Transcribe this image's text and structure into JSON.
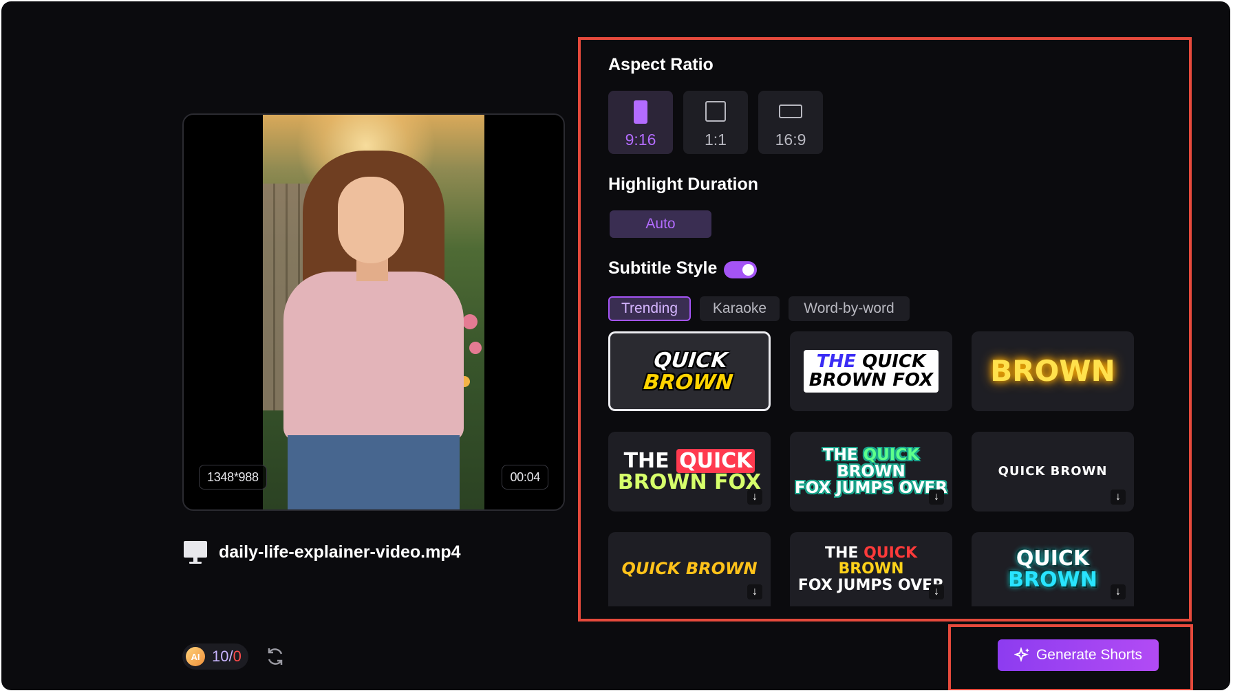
{
  "preview": {
    "resolution": "1348*988",
    "duration": "00:04",
    "file_name": "daily-life-explainer-video.mp4",
    "icon": "monitor-icon"
  },
  "credits": {
    "coin_label": "AI",
    "remaining": "10",
    "separator": "/",
    "used": "0",
    "refresh_icon": "refresh-icon"
  },
  "aspect_ratio": {
    "title": "Aspect Ratio",
    "options": [
      "9:16",
      "1:1",
      "16:9"
    ],
    "selected": "9:16"
  },
  "highlight": {
    "title": "Highlight Duration",
    "value": "Auto"
  },
  "subtitle": {
    "title": "Subtitle Style",
    "enabled": true,
    "tabs": [
      "Trending",
      "Karaoke",
      "Word-by-word"
    ],
    "active_tab": "Trending",
    "styles": [
      {
        "line1_a": "QUICK",
        "line1_b": "BROWN"
      },
      {
        "line1_a": "THE",
        "line1_b": "QUICK",
        "line2": "BROWN FOX"
      },
      {
        "line1_a": "BROWN"
      },
      {
        "line1_a": "THE",
        "line1_b": "QUICK",
        "line2": "BROWN FOX"
      },
      {
        "line1_a": "THE",
        "line1_b": "QUICK",
        "line1_c": "BROWN",
        "line2": "FOX JUMPS OVER"
      },
      {
        "line1_a": "QUICK BROWN"
      },
      {
        "line1_a": "QUICK BROWN"
      },
      {
        "line1_a": "THE",
        "line1_b": "QUICK",
        "line1_c": "BROWN",
        "line2": "FOX JUMPS OVER"
      },
      {
        "line1_a": "QUICK",
        "line1_b": "BROWN"
      }
    ],
    "download_icon": "download-icon"
  },
  "actions": {
    "generate_label": "Generate Shorts"
  },
  "colors": {
    "accent": "#a454f5",
    "highlight_box": "#e64a3c",
    "background": "#0b0b0e"
  }
}
